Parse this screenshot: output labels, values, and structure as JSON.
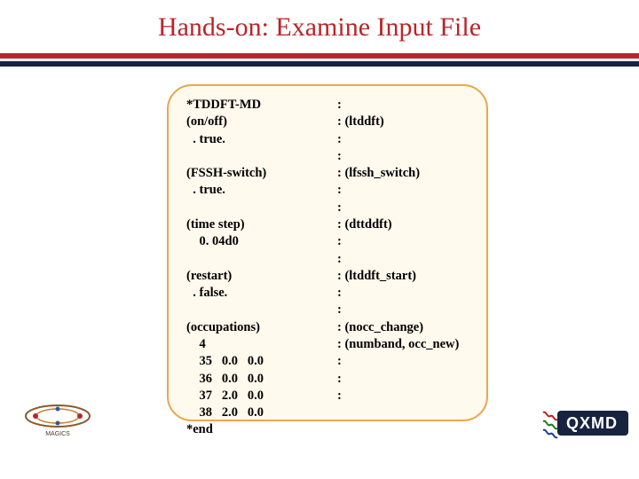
{
  "title": "Hands-on: Examine Input File",
  "input_left": "*TDDFT-MD\n(on/off)\n  . true.\n\n(FSSH-switch)\n  . true.\n\n(time step)\n    0. 04d0\n\n(restart)\n  . false.\n\n(occupations)\n    4\n    35   0.0   0.0\n    36   0.0   0.0\n    37   2.0   0.0\n    38   2.0   0.0\n*end",
  "input_right": ":\n: (ltddft)\n:\n:\n: (lfssh_switch)\n:\n:\n: (dttddft)\n:\n:\n: (ltddft_start)\n:\n:\n: (nocc_change)\n: (numband, occ_new)\n:\n:\n:",
  "logo_right_text": "QXMD",
  "chart_data": null
}
